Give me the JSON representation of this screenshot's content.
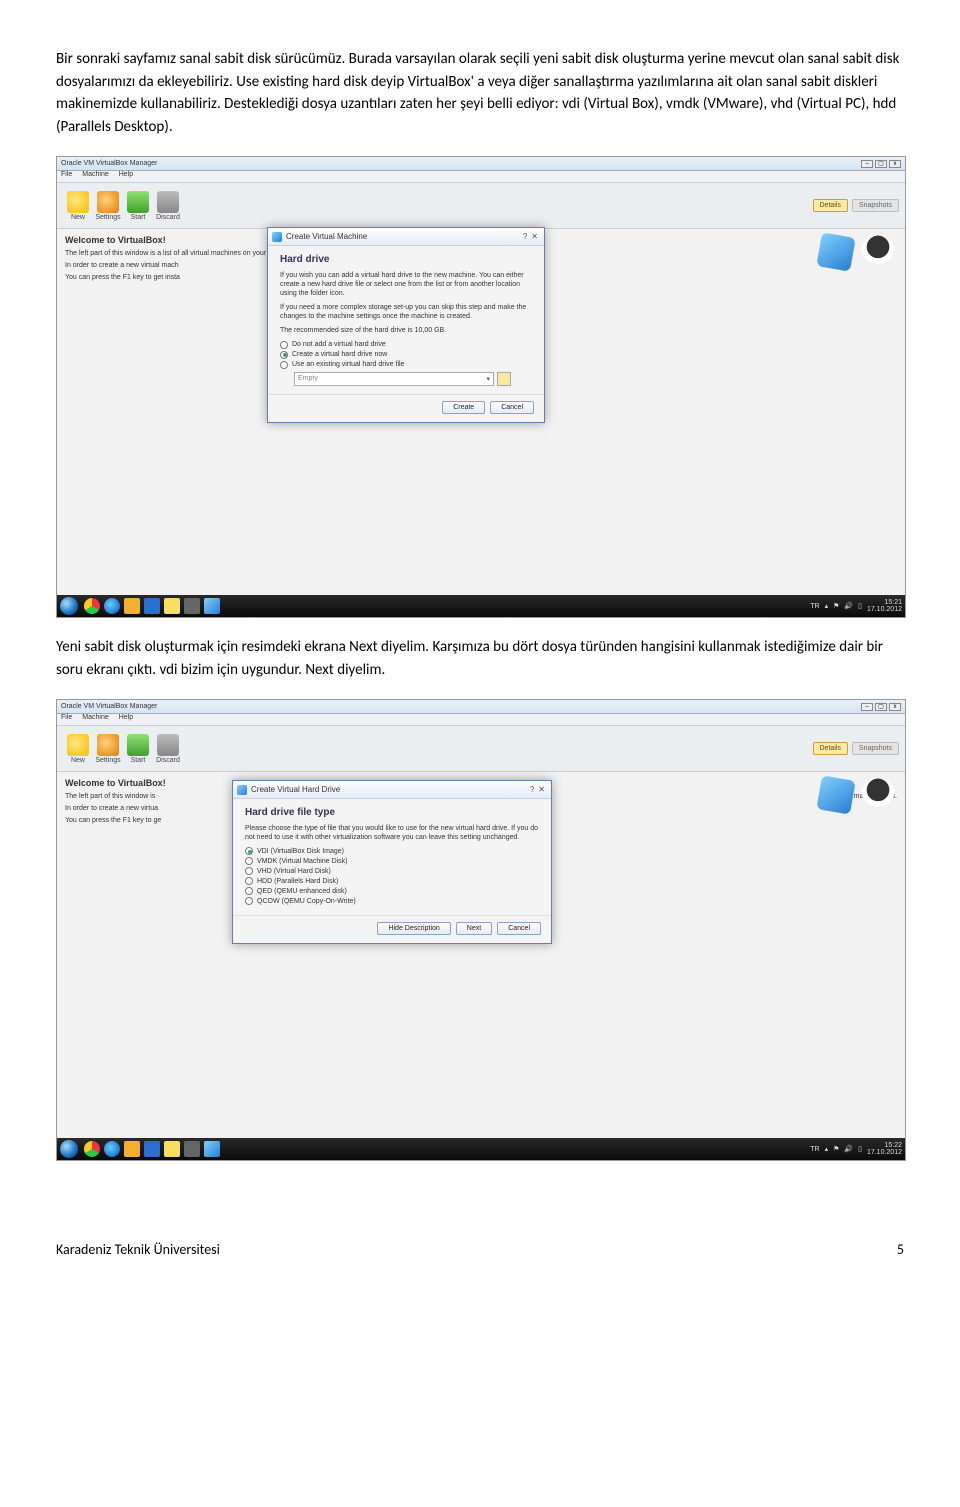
{
  "intro_para": "Bir sonraki sayfamız sanal sabit disk sürücümüz. Burada varsayılan olarak seçili yeni sabit disk oluşturma yerine mevcut olan sanal sabit disk dosyalarımızı da ekleyebiliriz. Use existing hard disk deyip VirtualBox' a veya diğer sanallaştırma yazılımlarına ait olan sanal sabit diskleri makinemizde kullanabiliriz. Desteklediği dosya uzantıları zaten her şeyi belli ediyor: vdi (Virtual Box), vmdk (VMware), vhd (Virtual PC), hdd (Parallels Desktop).",
  "mid_para": "Yeni sabit disk oluşturmak için resimdeki ekrana Next diyelim. Karşımıza bu dört dosya türünden hangisini kullanmak istediğimize dair bir soru ekranı çıktı. vdi bizim için uygundur. Next diyelim.",
  "footer_left": "Karadeniz Teknik Üniversitesi",
  "footer_right": "5",
  "app": {
    "title": "Oracle VM VirtualBox Manager",
    "menu": {
      "m1": "File",
      "m2": "Machine",
      "m3": "Help"
    },
    "tools": {
      "new": "New",
      "settings": "Settings",
      "start": "Start",
      "discard": "Discard"
    },
    "tabs": {
      "details": "Details",
      "snapshots": "Snapshots"
    },
    "welcome": {
      "title": "Welcome to VirtualBox!",
      "l1": "The left part of this window is a list of all virtual machines on your computer. The list is empty now because you haven't created any virtual machines yet.",
      "l2": "In order to create a new virtual mach",
      "l3": "You can press the F1 key to get insta"
    },
    "welcome2": {
      "l1short": "The left part of this window is",
      "l1tail": "ual machines yet.",
      "l2short": "In order to create a new virtua",
      "l3short": "You can press the F1 key to ge"
    }
  },
  "dialog1": {
    "title": "Create Virtual Machine",
    "heading": "Hard drive",
    "p1": "If you wish you can add a virtual hard drive to the new machine. You can either create a new hard drive file or select one from the list or from another location using the folder icon.",
    "p2": "If you need a more complex storage set-up you can skip this step and make the changes to the machine settings once the machine is created.",
    "p3": "The recommended size of the hard drive is 10,00 GB.",
    "r1": "Do not add a virtual hard drive",
    "r2": "Create a virtual hard drive now",
    "r3": "Use an existing virtual hard drive file",
    "combo": "Empty",
    "btn_ok": "Create",
    "btn_cancel": "Cancel"
  },
  "dialog2": {
    "title": "Create Virtual Hard Drive",
    "heading": "Hard drive file type",
    "p1": "Please choose the type of file that you would like to use for the new virtual hard drive. If you do not need to use it with other virtualization software you can leave this setting unchanged.",
    "r1": "VDI (VirtualBox Disk Image)",
    "r2": "VMDK (Virtual Machine Disk)",
    "r3": "VHD (Virtual Hard Disk)",
    "r4": "HDD (Parallels Hard Disk)",
    "r5": "QED (QEMU enhanced disk)",
    "r6": "QCOW (QEMU Copy-On-Write)",
    "btn_hide": "Hide Description",
    "btn_next": "Next",
    "btn_cancel": "Cancel"
  },
  "tray": {
    "lang": "TR",
    "time1": "15:21",
    "date1": "17.10.2012",
    "time2": "15:22",
    "date2": "17.10.2012"
  }
}
